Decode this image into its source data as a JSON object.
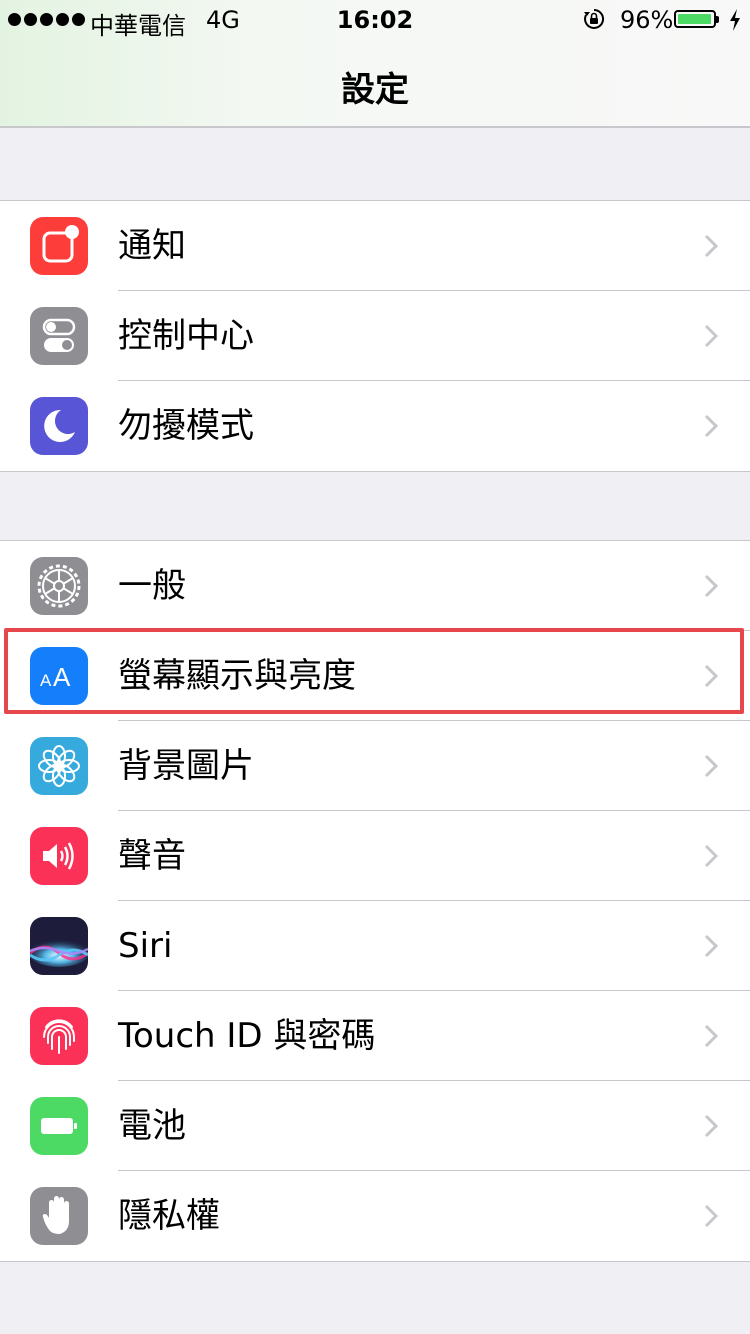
{
  "status_bar": {
    "carrier": "中華電信",
    "network": "4G",
    "time": "16:02",
    "battery_percent": "96%",
    "battery_level": 0.96,
    "icons": [
      "signal-dots-icon",
      "rotation-lock-icon",
      "battery-icon",
      "charging-bolt-icon"
    ]
  },
  "nav": {
    "title": "設定"
  },
  "groups": [
    {
      "items": [
        {
          "label": "通知",
          "icon": "notifications-icon",
          "color": "#fc3d39"
        },
        {
          "label": "控制中心",
          "icon": "control-center-icon",
          "color": "#8e8e93"
        },
        {
          "label": "勿擾模式",
          "icon": "moon-icon",
          "color": "#5856d6"
        }
      ]
    },
    {
      "items": [
        {
          "label": "一般",
          "icon": "gear-icon",
          "color": "#8e8e93"
        },
        {
          "label": "螢幕顯示與亮度",
          "icon": "text-size-icon",
          "color": "#147efb",
          "highlighted": true
        },
        {
          "label": "背景圖片",
          "icon": "flower-icon",
          "color": "#36aadc"
        },
        {
          "label": "聲音",
          "icon": "speaker-icon",
          "color": "#fc3158"
        },
        {
          "label": "Siri",
          "icon": "siri-icon",
          "color": "#1d1d3b"
        },
        {
          "label": "Touch ID 與密碼",
          "icon": "fingerprint-icon",
          "color": "#fc3158"
        },
        {
          "label": "電池",
          "icon": "battery-icon",
          "color": "#4cd964"
        },
        {
          "label": "隱私權",
          "icon": "hand-icon",
          "color": "#8e8e93"
        }
      ]
    }
  ],
  "highlight_color": "#e5474d"
}
